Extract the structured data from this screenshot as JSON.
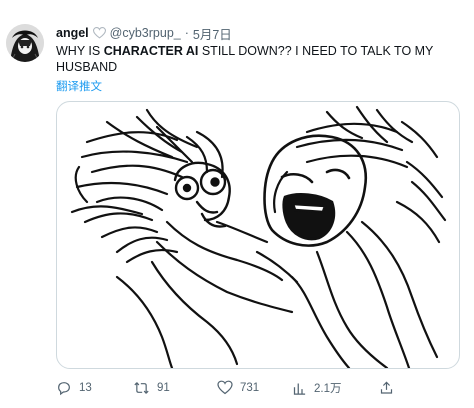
{
  "author": {
    "name": "angel",
    "handle": "@cyb3rpup_",
    "separator": "·",
    "date": "5月7日",
    "heart_icon": "heart-outline-icon"
  },
  "tweet": {
    "text_pre": "WHY IS ",
    "text_bold": "CHARACTER AI",
    "text_post": " STILL DOWN?? I NEED TO TALK TO MY HUSBAND",
    "translate_label": "翻译推文"
  },
  "actions": {
    "replies": "13",
    "retweets": "91",
    "likes": "731",
    "views": "2.1万"
  },
  "colors": {
    "text": "#0f1419",
    "secondary": "#536471",
    "link": "#1d9bf0",
    "border": "#cfd9de"
  }
}
